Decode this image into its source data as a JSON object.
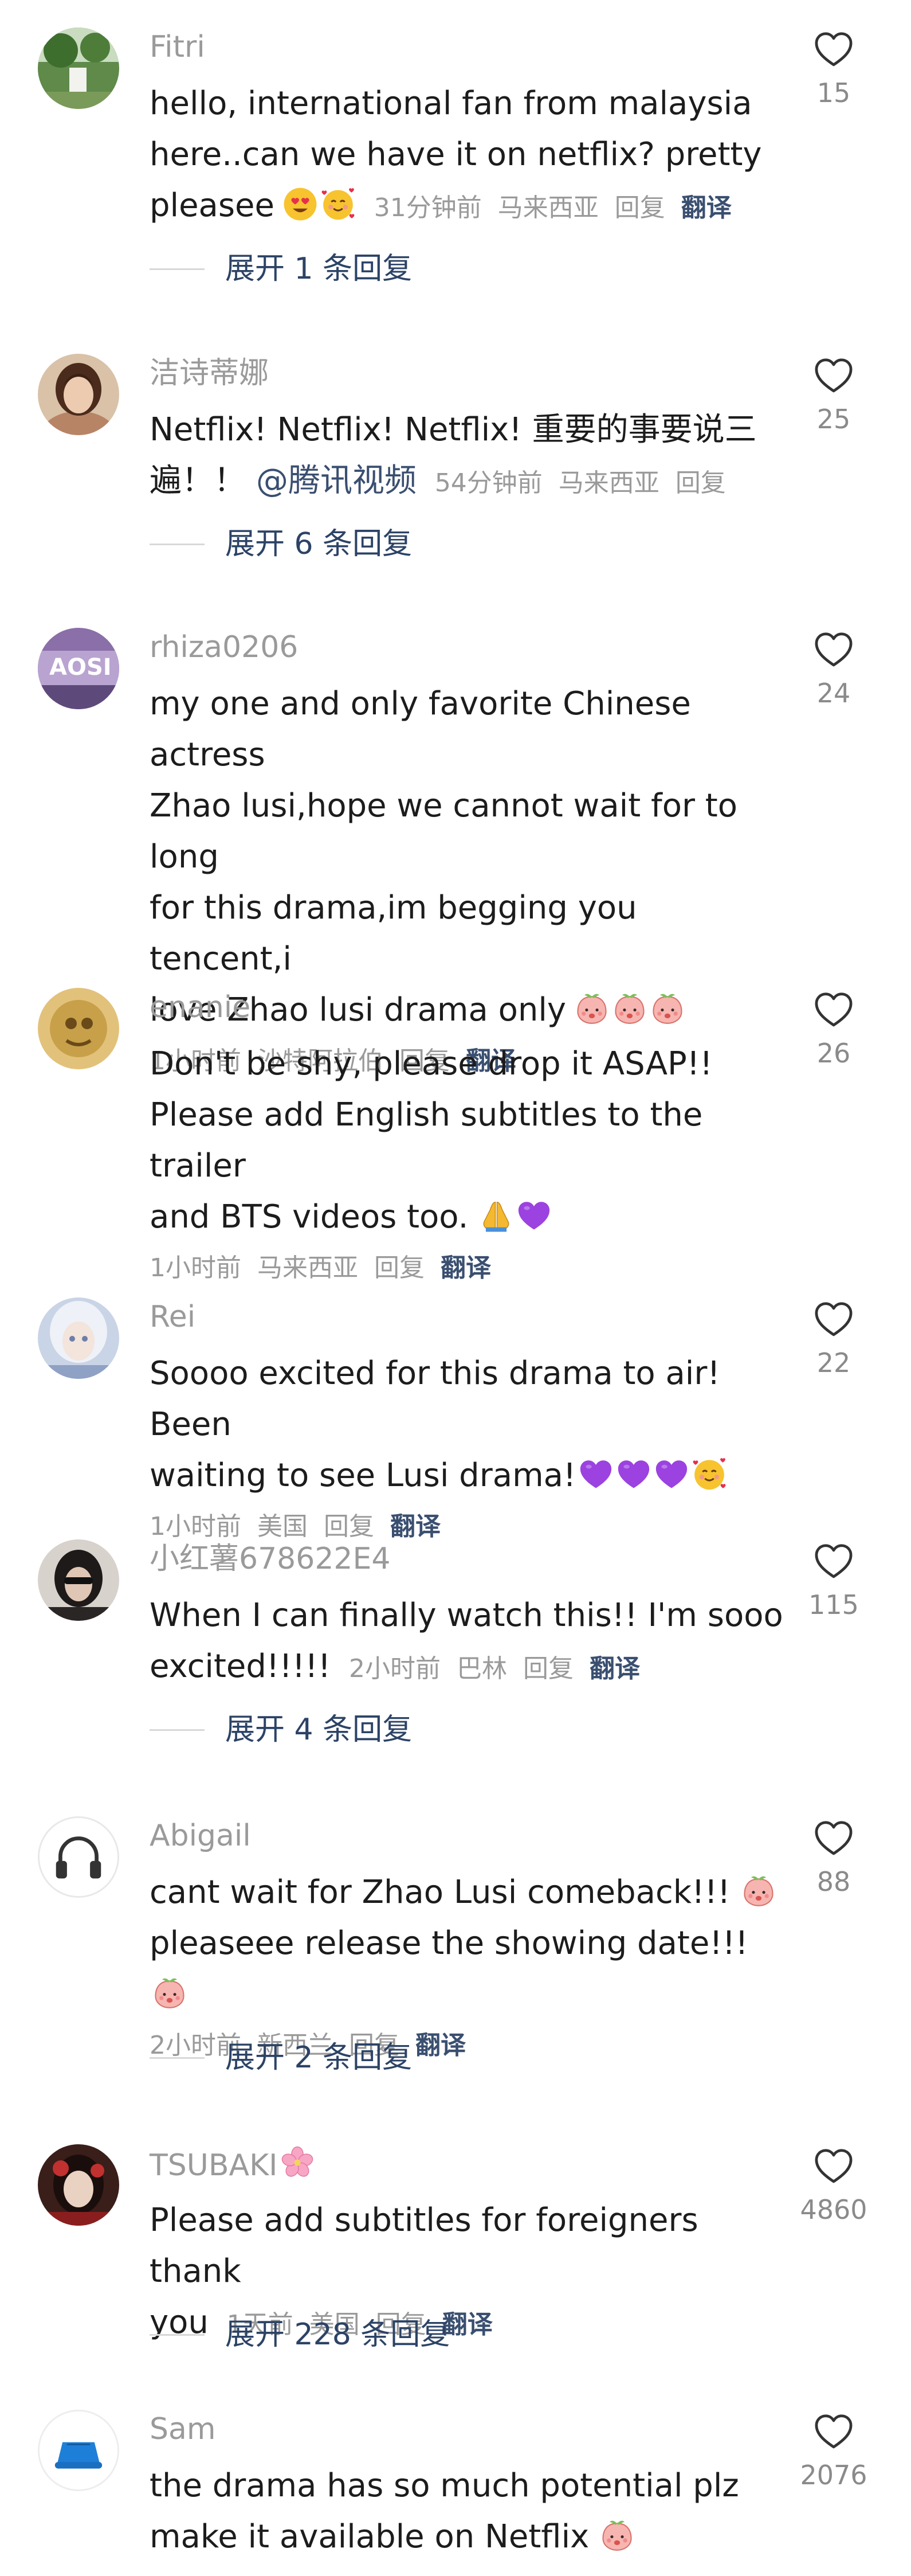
{
  "colors": {
    "username": "#9a9a9a",
    "body": "#1c1c1c",
    "link": "#3a4f70",
    "meta": "#9a9a9a",
    "heart_stroke": "#3a3a3a"
  },
  "comments": [
    {
      "username": "Fitri",
      "lines": [
        "hello, international fan from malaysia",
        "here..can we have it on netflix? pretty",
        "pleasee"
      ],
      "emojis": [
        "heart-eyes-emoji",
        "smiling-hearts-emoji"
      ],
      "time": "31分钟前",
      "location": "马来西亚",
      "reply": "回复",
      "translate": "翻译",
      "likes": "15",
      "expand": "展开 1 条回复"
    },
    {
      "username": "洁诗蒂娜",
      "lines": [
        "Netflix! Netflix! Netflix! 重要的事要说三",
        "遍！！"
      ],
      "mention": "@腾讯视频",
      "time": "54分钟前",
      "location": "马来西亚",
      "reply": "回复",
      "likes": "25",
      "expand": "展开 6 条回复"
    },
    {
      "username": "rhiza0206",
      "lines": [
        "my one and only favorite Chinese actress",
        "Zhao lusi,hope we cannot wait for to long",
        "for this drama,im begging you tencent,i",
        "love Zhao lusi drama only"
      ],
      "emojis": [
        "peach-face-emoji",
        "peach-face-emoji",
        "peach-face-emoji"
      ],
      "time": "1小时前",
      "location": "沙特阿拉伯",
      "reply": "回复",
      "translate": "翻译",
      "likes": "24"
    },
    {
      "username": "enanie",
      "lines": [
        "Don't be shy, please drop it ASAP!!",
        "Please add English subtitles to the trailer",
        "and BTS videos too."
      ],
      "emojis": [
        "folded-hands-emoji",
        "purple-heart-emoji"
      ],
      "time": "1小时前",
      "location": "马来西亚",
      "reply": "回复",
      "translate": "翻译",
      "likes": "26"
    },
    {
      "username": "Rei",
      "lines": [
        "Soooo excited for this drama to air! Been",
        "waiting to see Lusi drama!"
      ],
      "emojis": [
        "purple-heart-emoji",
        "purple-heart-emoji",
        "purple-heart-emoji",
        "smiling-hearts-emoji"
      ],
      "time": "1小时前",
      "location": "美国",
      "reply": "回复",
      "translate": "翻译",
      "likes": "22"
    },
    {
      "username": "小红薯678622E4",
      "lines": [
        "When I can finally watch this!! I'm sooo",
        "excited!!!!!"
      ],
      "time": "2小时前",
      "location": "巴林",
      "reply": "回复",
      "translate": "翻译",
      "likes": "115",
      "expand": "展开 4 条回复"
    },
    {
      "username": "Abigail",
      "lines": [
        "cant wait for Zhao Lusi comeback!!!",
        "pleaseee release the showing date!!!"
      ],
      "emojis": [
        "peach-face-emoji",
        "peach-face-emoji"
      ],
      "time": "2小时前",
      "location": "新西兰",
      "reply": "回复",
      "translate": "翻译",
      "likes": "88",
      "expand": "展开 2 条回复"
    },
    {
      "username": "TSUBAKI",
      "username_emoji": "cherry-blossom-emoji",
      "lines": [
        "Please add subtitles for foreigners thank",
        "you"
      ],
      "time": "1天前",
      "location": "美国",
      "reply": "回复",
      "translate": "翻译",
      "likes": "4860",
      "expand": "展开 228 条回复"
    },
    {
      "username": "Sam",
      "lines": [
        "the drama has so much potential plz",
        "make it available on Netflix"
      ],
      "emojis": [
        "peach-face-emoji"
      ],
      "likes": "2076"
    }
  ]
}
